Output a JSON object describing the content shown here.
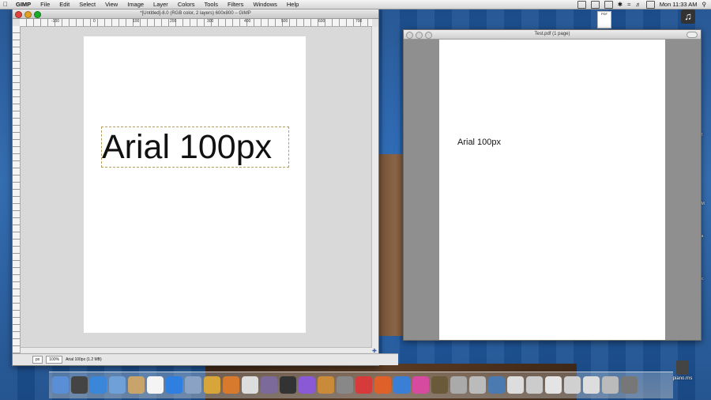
{
  "menubar": {
    "app_name": "GIMP",
    "items": [
      "File",
      "Edit",
      "Select",
      "View",
      "Image",
      "Layer",
      "Colors",
      "Tools",
      "Filters",
      "Windows",
      "Help"
    ],
    "clock": "Mon 11:33 AM"
  },
  "gimp_window": {
    "title": "*[Untitled]-8.0 (RGB color, 2 layers) 600x800 – GIMP",
    "ruler_labels": [
      "-100",
      "0",
      "100",
      "200",
      "300",
      "400",
      "500",
      "600",
      "700"
    ],
    "text_layer": "Arial 100px",
    "status": {
      "unit": "px",
      "zoom": "100%",
      "info": "Arial 100px (1.2 MB)"
    }
  },
  "pdf_window": {
    "title": "Test.pdf (1 page)",
    "page_text": "Arial 100px"
  },
  "desktop": {
    "file_label": "PDF",
    "file_icon_label": "piano.rns",
    "edge_labels": [
      "4r",
      "3",
      "12",
      "n",
      "RM",
      "a",
      "wa",
      "etc"
    ]
  },
  "colors": {
    "close": "#e0443e",
    "minimize": "#dea123",
    "zoom": "#1aab29"
  }
}
